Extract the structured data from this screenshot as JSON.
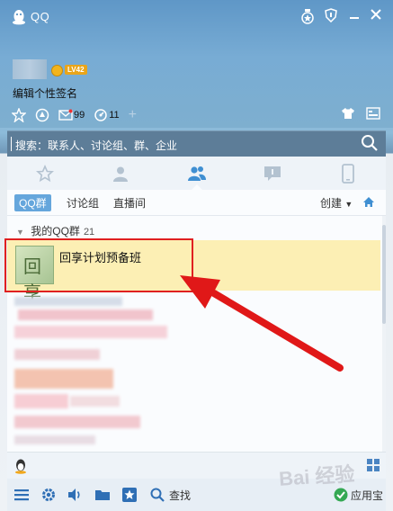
{
  "window": {
    "title": "QQ",
    "accent": "#65a6dc"
  },
  "titlebar": {
    "icons": [
      "medal-icon",
      "shield-icon",
      "minimize-icon",
      "close-icon"
    ]
  },
  "profile": {
    "level": "LV42",
    "signature": "编辑个性签名"
  },
  "quick_icons": [
    {
      "name": "star-icon"
    },
    {
      "name": "space-icon"
    },
    {
      "name": "mail-icon",
      "count": "99"
    },
    {
      "name": "update-icon",
      "count": "11"
    },
    {
      "name": "plus-icon"
    }
  ],
  "right_icons": [
    "shirt-icon",
    "manager-icon"
  ],
  "search": {
    "placeholder": "搜索：联系人、讨论组、群、企业"
  },
  "tabs": [
    "star-icon",
    "contact-icon",
    "group-icon",
    "chat-icon",
    "phone-icon"
  ],
  "subtabs": {
    "qq_group": "QQ群",
    "discussion": "讨论组",
    "live": "直播间",
    "create": "创建"
  },
  "group_list": {
    "header": "我的QQ群",
    "count": "21",
    "selected_name": "回享计划预备班",
    "avatar_text": "回享"
  },
  "bottom": {
    "find": "查找",
    "appstore": "应用宝"
  },
  "watermark": "Bai 经验"
}
